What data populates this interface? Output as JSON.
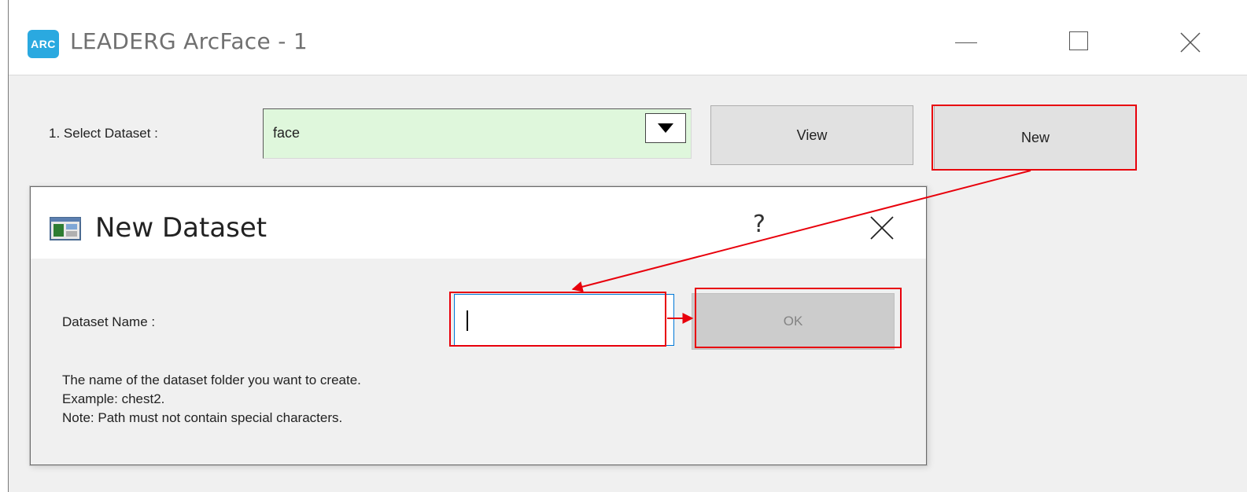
{
  "window": {
    "logo_text": "ARC",
    "title": "LEADERG ArcFace - 1"
  },
  "main": {
    "select_label": "1. Select Dataset :",
    "dataset_value": "face",
    "view_label": "View",
    "new_label": "New"
  },
  "dialog": {
    "title": "New Dataset",
    "help": "?",
    "name_label": "Dataset Name :",
    "name_value": "",
    "ok_label": "OK",
    "hint_lines": [
      "The name of the dataset folder you want to create.",
      "Example: chest2.",
      "Note: Path must not contain special characters."
    ]
  },
  "colors": {
    "combo_bg": "#dff7dc",
    "highlight": "#e8000b",
    "logo_bg": "#2aa9e0",
    "input_border": "#0078d7"
  },
  "icons": {
    "app": "arc-logo-icon",
    "dialog": "dataset-window-icon",
    "dropdown": "triangle-down-icon",
    "minimize": "minimize-icon",
    "maximize": "maximize-icon",
    "close": "close-icon"
  }
}
